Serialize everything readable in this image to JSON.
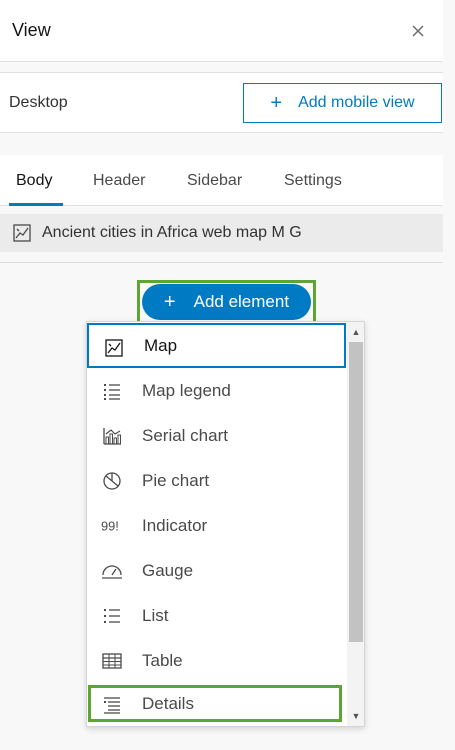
{
  "panel": {
    "title": "View",
    "close_icon": "close-icon"
  },
  "device": {
    "label": "Desktop",
    "add_mobile_label": "Add mobile view"
  },
  "tabs": [
    {
      "label": "Body",
      "active": true
    },
    {
      "label": "Header",
      "active": false
    },
    {
      "label": "Sidebar",
      "active": false
    },
    {
      "label": "Settings",
      "active": false
    }
  ],
  "body_elements": [
    {
      "icon": "map-icon",
      "label": "Ancient cities in Africa web map M G"
    }
  ],
  "add_element": {
    "label": "Add element",
    "icon": "plus-icon"
  },
  "dropdown": {
    "items": [
      {
        "icon": "map-icon",
        "label": "Map",
        "state": "selected"
      },
      {
        "icon": "map-legend-icon",
        "label": "Map legend"
      },
      {
        "icon": "serial-chart-icon",
        "label": "Serial chart"
      },
      {
        "icon": "pie-chart-icon",
        "label": "Pie chart"
      },
      {
        "icon": "indicator-icon",
        "label": "Indicator"
      },
      {
        "icon": "gauge-icon",
        "label": "Gauge"
      },
      {
        "icon": "list-icon",
        "label": "List"
      },
      {
        "icon": "table-icon",
        "label": "Table"
      },
      {
        "icon": "details-icon",
        "label": "Details",
        "state": "highlighted"
      }
    ]
  },
  "colors": {
    "accent": "#007ac2",
    "highlight": "#5ea632"
  }
}
